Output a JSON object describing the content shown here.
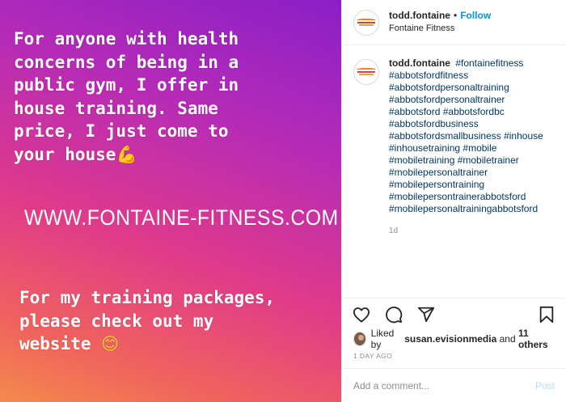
{
  "story": {
    "lines_top": [
      "For anyone with health",
      "concerns of being in a",
      "public gym, I offer in",
      "house training. Same",
      "price, I just come to",
      "your house"
    ],
    "muscle_emoji": "💪",
    "url": "WWW.FONTAINE-FITNESS.COM",
    "lines_bottom": [
      "For my training packages,",
      "please check out my",
      "website "
    ],
    "smile_emoji": "😊"
  },
  "header": {
    "username": "todd.fontaine",
    "separator": "•",
    "follow_label": "Follow",
    "subtitle": "Fontaine Fitness"
  },
  "caption": {
    "username": "todd.fontaine",
    "first_tag": "#fontainefitness",
    "tag_lines": [
      "#abbotsfordfitness",
      "#abbotsfordpersonaltraining",
      "#abbotsfordpersonaltrainer",
      "#abbotsford #abbotsfordbc",
      "#abbotsfordbusiness",
      "#abbotsfordsmallbusiness #inhouse",
      "#inhousetraining #mobile",
      "#mobiletraining #mobiletrainer",
      "#mobilepersonaltrainer",
      "#mobilepersontraining",
      "#mobilepersontrainerabbotsford",
      "#mobilepersonaltrainingabbotsford"
    ],
    "time": "1d"
  },
  "likes": {
    "prefix": "Liked by",
    "user": "susan.evisionmedia",
    "and": "and",
    "others": "11 others"
  },
  "date_ago": "1 DAY AGO",
  "comment": {
    "placeholder": "Add a comment...",
    "post_label": "Post"
  },
  "icons": [
    "heart-icon",
    "comment-icon",
    "share-icon",
    "bookmark-icon"
  ],
  "colors": {
    "link": "#0095f6",
    "hashtag": "#00376b",
    "muted": "#8e8e8e",
    "post_disabled": "#b2dffc"
  }
}
